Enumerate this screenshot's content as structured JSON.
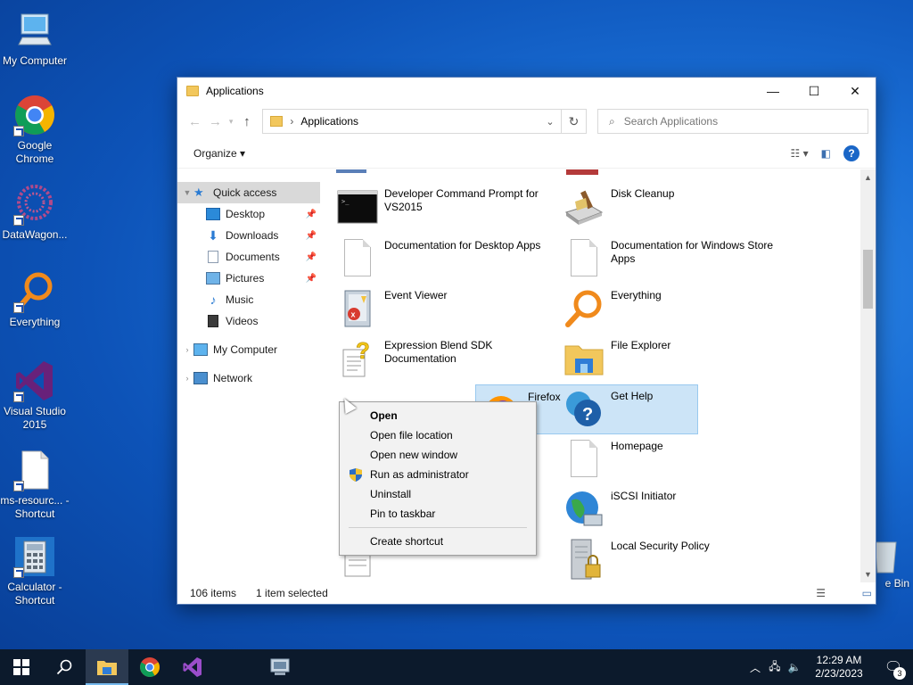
{
  "desktop": {
    "icons": [
      {
        "label": "My Computer"
      },
      {
        "label": "Google Chrome"
      },
      {
        "label": "DataWagon..."
      },
      {
        "label": "Everything"
      },
      {
        "label": "Visual Studio 2015"
      },
      {
        "label": "ms-resourc... - Shortcut"
      },
      {
        "label": "Calculator - Shortcut"
      }
    ],
    "recycle_bin_label": "e Bin"
  },
  "window": {
    "title": "Applications",
    "address": {
      "path": "Applications"
    },
    "search": {
      "placeholder": "Search Applications"
    },
    "organize_label": "Organize",
    "nav": [
      {
        "label": "Quick access"
      },
      {
        "label": "Desktop"
      },
      {
        "label": "Downloads"
      },
      {
        "label": "Documents"
      },
      {
        "label": "Pictures"
      },
      {
        "label": "Music"
      },
      {
        "label": "Videos"
      },
      {
        "label": "My Computer"
      },
      {
        "label": "Network"
      }
    ],
    "items_left": [
      {
        "label": "Developer Command Prompt for VS2015"
      },
      {
        "label": "Documentation for Desktop Apps"
      },
      {
        "label": "Event Viewer"
      },
      {
        "label": "Expression Blend SDK Documentation"
      },
      {
        "label": "Firefox"
      }
    ],
    "items_right": [
      {
        "label": "Disk Cleanup"
      },
      {
        "label": "Documentation for Windows Store Apps"
      },
      {
        "label": "Everything"
      },
      {
        "label": "File Explorer"
      },
      {
        "label": "Get Help"
      },
      {
        "label": "Homepage"
      },
      {
        "label": "iSCSI Initiator"
      },
      {
        "label": "Local Security Policy"
      }
    ],
    "status": {
      "count": "106 items",
      "selected": "1 item selected"
    }
  },
  "context_menu": {
    "items": [
      {
        "label": "Open"
      },
      {
        "label": "Open file location"
      },
      {
        "label": "Open new window"
      },
      {
        "label": "Run as administrator"
      },
      {
        "label": "Uninstall"
      },
      {
        "label": "Pin to taskbar"
      },
      {
        "label": "Create shortcut"
      }
    ]
  },
  "taskbar": {
    "time": "12:29 AM",
    "date": "2/23/2023",
    "notification_count": "3"
  },
  "colors": {
    "accent": "#0078d7",
    "selection": "#cce4f7",
    "taskbar": "#0c1a2c"
  }
}
